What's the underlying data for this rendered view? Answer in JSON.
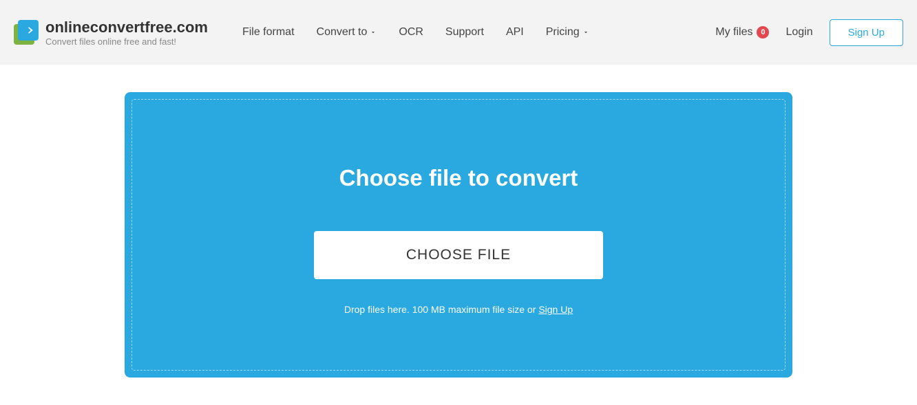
{
  "brand": {
    "title": "onlineconvertfree.com",
    "tagline": "Convert files online free and fast!"
  },
  "nav": {
    "file_format": "File format",
    "convert_to": "Convert to",
    "ocr": "OCR",
    "support": "Support",
    "api": "API",
    "pricing": "Pricing"
  },
  "actions": {
    "my_files": "My files",
    "my_files_count": "0",
    "login": "Login",
    "signup": "Sign Up"
  },
  "dropzone": {
    "title": "Choose file to convert",
    "button": "CHOOSE FILE",
    "hint_prefix": "Drop files here. 100 MB maximum file size or ",
    "hint_link": "Sign Up"
  }
}
